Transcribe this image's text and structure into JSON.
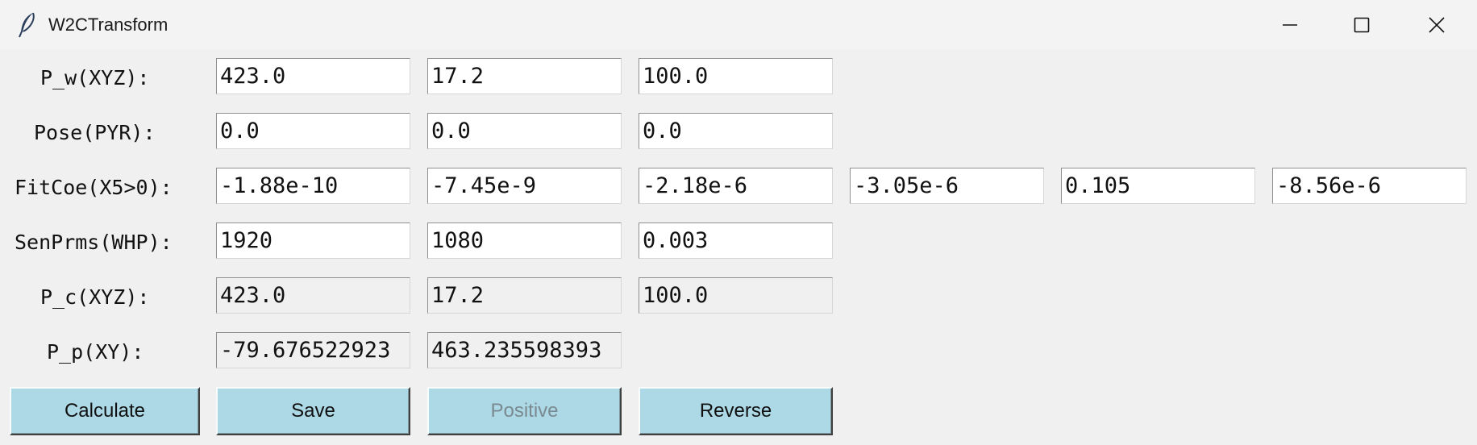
{
  "window": {
    "title": "W2CTransform",
    "icon": "feather-icon",
    "controls": [
      "minimize-icon",
      "maximize-icon",
      "close-icon"
    ]
  },
  "rows": [
    {
      "label": "P_w(XYZ):",
      "readonly": false,
      "values": [
        "423.0",
        "17.2",
        "100.0"
      ]
    },
    {
      "label": "Pose(PYR):",
      "readonly": false,
      "values": [
        "0.0",
        "0.0",
        "0.0"
      ]
    },
    {
      "label": "FitCoe(X5>0):",
      "readonly": false,
      "values": [
        "-1.88e-10",
        "-7.45e-9",
        "-2.18e-6",
        "-3.05e-6",
        "0.105",
        "-8.56e-6"
      ]
    },
    {
      "label": "SenPrms(WHP):",
      "readonly": false,
      "values": [
        "1920",
        "1080",
        "0.003"
      ]
    },
    {
      "label": "P_c(XYZ):",
      "readonly": true,
      "values": [
        "423.0",
        "17.2",
        "100.0"
      ]
    },
    {
      "label": "P_p(XY):",
      "readonly": true,
      "values": [
        "-79.676522923",
        "463.235598393"
      ]
    }
  ],
  "buttons": [
    {
      "label": "Calculate",
      "enabled": true
    },
    {
      "label": "Save",
      "enabled": true
    },
    {
      "label": "Positive",
      "enabled": false
    },
    {
      "label": "Reverse",
      "enabled": true
    }
  ],
  "colors": {
    "button_bg": "#add8e6",
    "window_bg": "#f0f0f0",
    "entry_bg": "#ffffff"
  }
}
